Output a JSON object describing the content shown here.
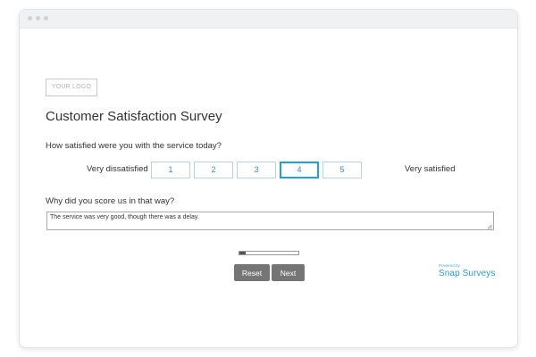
{
  "logo": {
    "text": "YOUR LOGO"
  },
  "survey": {
    "title": "Customer Satisfaction Survey",
    "question1": "How satisfied were you with the service today?",
    "scale": {
      "left_label": "Very dissatisfied",
      "right_label": "Very satisfied",
      "options": [
        "1",
        "2",
        "3",
        "4",
        "5"
      ],
      "selected": "4"
    },
    "question2": "Why did you score us in that way?",
    "answer": "The service was very good, though there was a delay."
  },
  "progress": {
    "fraction": 0.1
  },
  "buttons": {
    "reset": "Reset",
    "next": "Next"
  },
  "brand": {
    "powered_by": "Powered by",
    "name": "Snap Surveys"
  },
  "colors": {
    "accent": "#19a4dd",
    "button": "#757575",
    "brand": "#2a9ad8"
  }
}
